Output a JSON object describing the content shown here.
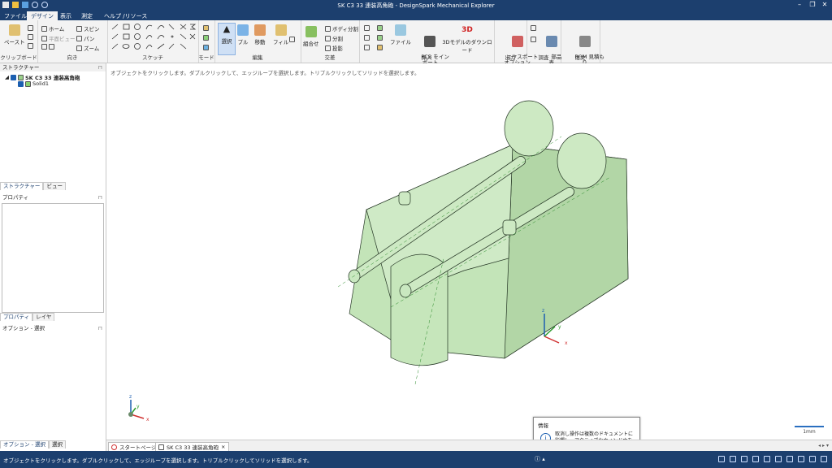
{
  "window": {
    "title": "SK C3 33 連装高角砲 - DesignSpark Mechanical Explorer",
    "min": "–",
    "restore": "❐",
    "close": "✕"
  },
  "menu": {
    "tabs": [
      "ファイル",
      "デザイン",
      "表示",
      "測定",
      "ヘルプ /リソース"
    ],
    "active_index": 1
  },
  "ribbon": {
    "clipboard": {
      "label": "クリップボード",
      "paste": "ペースト"
    },
    "orient": {
      "label": "向き",
      "home": "ホーム",
      "plane_view": "平面ビュー",
      "spin": "スピン",
      "pan": "パン",
      "zoom": "ズーム"
    },
    "sketch": {
      "label": "スケッチ"
    },
    "mode": {
      "label": "モード"
    },
    "edit": {
      "label": "編集",
      "select": "選択",
      "pull": "プル",
      "move": "移動",
      "fill": "フィル"
    },
    "intersect": {
      "label": "交差",
      "combine": "組合せ",
      "split_body": "ボディ分割",
      "split": "分割",
      "project": "投影"
    },
    "insert": {
      "label": "挿入",
      "file": "ファイル",
      "pcb": "PCB をイン\nポート",
      "model3d": "3Dモデルのダウンロード"
    },
    "output": {
      "label": "出力",
      "export": "エクスポート\nオプション"
    },
    "investigate": {
      "label": "調査",
      "parts": "部品\n表"
    },
    "order": {
      "label": "注文",
      "bom": "BOM 見積も\nり"
    }
  },
  "sidebar": {
    "structure_title": "ストラクチャー",
    "tree_root": "SK C3 33 連装高角砲",
    "tree_child": "Solid1",
    "tabs1": [
      "ストラクチャー",
      "ビュー"
    ],
    "properties_title": "プロパティ",
    "tabs2": [
      "プロパティ",
      "レイヤ"
    ],
    "options_title": "オプション - 選択",
    "tabs3": [
      "オプション - 選択",
      "選択"
    ]
  },
  "viewport": {
    "hint": "オブジェクトをクリックします。ダブルクリックして、エッジループを選択します。トリプルクリックしてソリッドを選択します。",
    "scale_label": "1mm",
    "axis_x": "x",
    "axis_y": "y",
    "axis_z": "z"
  },
  "doc_tabs": {
    "start": "スタートページ",
    "doc": "SK C3 33 連装高角砲",
    "close": "×"
  },
  "info": {
    "title": "情報",
    "body": "取消し操作は複数のドキュメントに影響し、アクティブなウィンドウを変更することがあります。"
  },
  "status": {
    "text": "オブジェクトをクリックします。ダブルクリックして、エッジループを選択します。トリプルクリックしてソリッドを選択します。"
  },
  "colors": {
    "titlebar": "#1c3f6e",
    "ribbon": "#f3f3f3",
    "model": "#c9e8c0",
    "model_edge": "#223322"
  }
}
